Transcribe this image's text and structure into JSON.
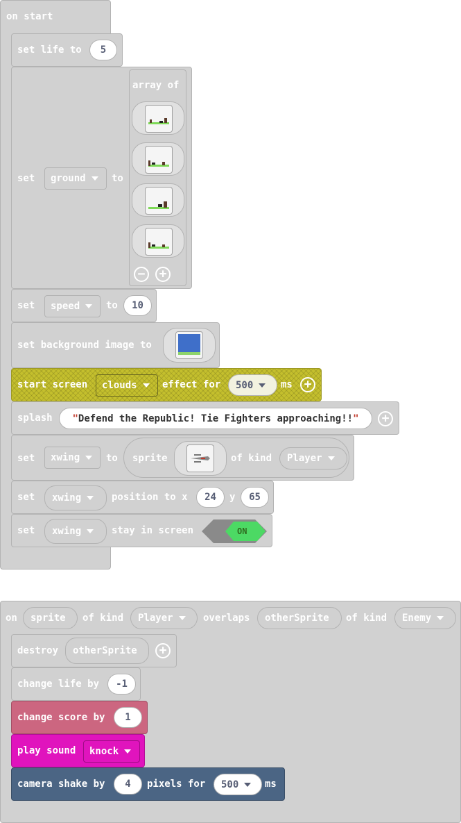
{
  "colors": {
    "block_gray": "#d1d1d1",
    "scene_yellow": "#c4bf2d",
    "sprites_pink": "#cc6680",
    "music_magenta": "#e014bd",
    "camera_blue": "#4b6584",
    "toggle_green": "#4cd964"
  },
  "on_start": {
    "hat": "on start",
    "set_life": {
      "set_label": "set life to",
      "value": "5"
    },
    "set_ground": {
      "set_label": "set",
      "var": "ground",
      "to_label": "to",
      "array_label": "array of",
      "images": [
        "ground-image-1",
        "ground-image-2",
        "ground-image-3",
        "ground-image-4"
      ],
      "minus": "⊖",
      "plus": "⊕"
    },
    "set_speed": {
      "set_label": "set",
      "var": "speed",
      "to_label": "to",
      "value": "10"
    },
    "set_background": {
      "label": "set background image to"
    },
    "start_screen": {
      "label": "start screen",
      "effect": "clouds",
      "for_label": "effect for",
      "ms_value": "500",
      "ms_label": "ms"
    },
    "splash": {
      "label": "splash",
      "quote_open": "\"",
      "text": "Defend the Republic! Tie Fighters approaching!!",
      "quote_close": "\""
    },
    "set_xwing_sprite": {
      "set_label": "set",
      "var": "xwing",
      "to_label": "to",
      "sprite_label": "sprite",
      "of_kind_label": "of kind",
      "kind": "Player"
    },
    "set_position": {
      "set_label": "set",
      "var": "xwing",
      "label": "position to x",
      "x": "24",
      "y_label": "y",
      "y": "65"
    },
    "stay_in_screen": {
      "set_label": "set",
      "var": "xwing",
      "label": "stay in screen",
      "toggle": "ON"
    }
  },
  "overlap_event": {
    "on_label": "on",
    "sprite": "sprite",
    "of_kind_label": "of kind",
    "kind1": "Player",
    "overlaps_label": "overlaps",
    "other": "otherSprite",
    "of_kind_label2": "of kind",
    "kind2": "Enemy",
    "destroy": {
      "label": "destroy",
      "target": "otherSprite"
    },
    "change_life": {
      "label": "change life by",
      "value": "-1"
    },
    "change_score": {
      "label": "change score by",
      "value": "1"
    },
    "play_sound": {
      "label": "play sound",
      "sound": "knock"
    },
    "camera_shake": {
      "label": "camera shake by",
      "value": "4",
      "pixels_label": "pixels for",
      "ms_value": "500",
      "ms_label": "ms"
    }
  }
}
